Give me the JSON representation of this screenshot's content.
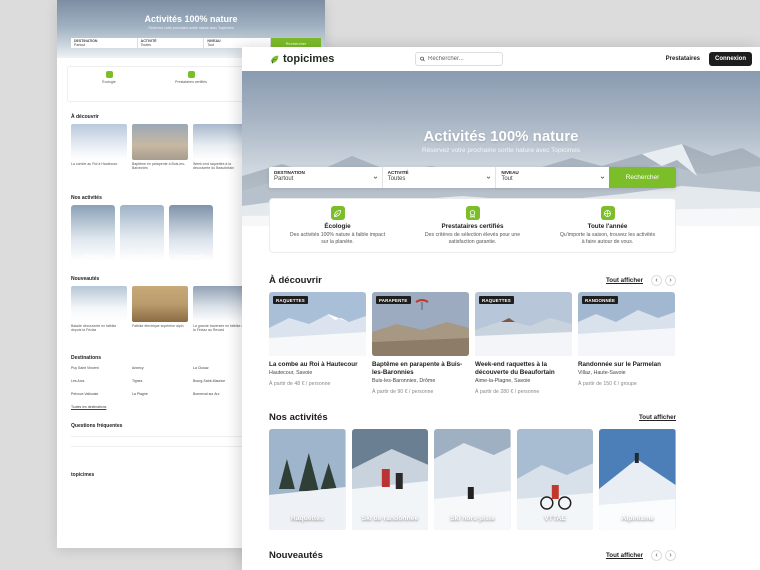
{
  "back_page": {
    "hero_title": "Activités 100% nature",
    "hero_sub": "Réservez votre prochaine sortie nature avec Topicimes",
    "search_fields": [
      {
        "label": "DESTINATION",
        "value": "Partout"
      },
      {
        "label": "ACTIVITÉ",
        "value": "Toutes"
      },
      {
        "label": "NIVEAU",
        "value": "Tout"
      }
    ],
    "search_button": "Rechercher",
    "features": [
      "Écologie",
      "Prestataires certifiés",
      "Toute l'année"
    ],
    "discover_title": "À découvrir",
    "cards": [
      {
        "badge": "RAQUETTES",
        "title": "La combe au Roi à Hautecour",
        "loc": "Hautecour, Savoie"
      },
      {
        "badge": "PARAPENTE",
        "title": "Baptême en parapente à Buis-les-Baronnies",
        "loc": "Buis-les-Baronnies, Drôme"
      },
      {
        "badge": "RAQUETTES",
        "title": "Week-end raquettes à la découverte du Beaufortain",
        "loc": "Aime-la-Plagne, Savoie"
      }
    ],
    "activities_title": "Nos activités",
    "activities": [
      "Raquettes",
      "Ski de randonnée",
      "Ski hors-piste"
    ],
    "news_title": "Nouveautés",
    "news": [
      {
        "badge": "FAT BIKE",
        "title": "Balade découverte en fatbike depuis la Féclaz"
      },
      {
        "badge": "FAT BIKE",
        "title": "Fatbike électrique supérieur alpin"
      },
      {
        "badge": "FAT BIKE",
        "title": "La grande traversée en fatbike de la Féclaz au Revard"
      }
    ],
    "destinations_title": "Destinations",
    "destinations": [
      "Puy Saint Vincent",
      "Annecy",
      "La Clusaz",
      "Les Arcs",
      "Tignes",
      "Bourg-Saint-Maurice",
      "Pelvoux Vallouise",
      "La Plagne",
      "Bonneval sur Arc"
    ],
    "all_destinations": "Toutes les destinations",
    "faq_title": "Questions fréquentes",
    "footer_brand": "topicimes"
  },
  "nav": {
    "brand": "topicimes",
    "search_placeholder": "Rechercher...",
    "link_providers": "Prestataires",
    "login": "Connexion"
  },
  "hero": {
    "title": "Activités 100% nature",
    "subtitle": "Réservez votre prochaine sortie nature avec Topicimes"
  },
  "search": {
    "fields": [
      {
        "label": "DESTINATION",
        "value": "Partout"
      },
      {
        "label": "ACTIVITÉ",
        "value": "Toutes"
      },
      {
        "label": "NIVEAU",
        "value": "Tout"
      }
    ],
    "button": "Rechercher"
  },
  "features": [
    {
      "icon": "leaf-icon",
      "title": "Écologie",
      "desc": "Des activités 100% nature à faible impact sur la planète."
    },
    {
      "icon": "certificate-icon",
      "title": "Prestataires certifiés",
      "desc": "Des critères de sélection élevés pour une satisfaction garantie."
    },
    {
      "icon": "sun-snow-icon",
      "title": "Toute l'année",
      "desc": "Qu'importe la saison, trouvez les activités à faire autour de vous."
    }
  ],
  "discover": {
    "title": "À découvrir",
    "see_all": "Tout afficher",
    "cards": [
      {
        "badge": "RAQUETTES",
        "title": "La combe au Roi à Hautecour",
        "location": "Hautecour, Savoie",
        "price": "À partir de 48 € / personne"
      },
      {
        "badge": "PARAPENTE",
        "title": "Baptême en parapente à Buis-les-Baronnies",
        "location": "Buis-les-Baronnies, Drôme",
        "price": "À partir de 90 € / personne"
      },
      {
        "badge": "RAQUETTES",
        "title": "Week-end raquettes à la découverte du Beaufortain",
        "location": "Aime-la-Plagne, Savoie",
        "price": "À partir de 280 € / personne"
      },
      {
        "badge": "RANDONNÉE",
        "title": "Randonnée sur le Parmelan",
        "location": "Villaz, Haute-Savoie",
        "price": "À partir de 150 € / groupe"
      }
    ]
  },
  "activities": {
    "title": "Nos activités",
    "see_all": "Tout afficher",
    "items": [
      "Raquettes",
      "Ski de randonnée",
      "Ski hors-piste",
      "VTTAE",
      "Alpinisme"
    ]
  },
  "news": {
    "title": "Nouveautés",
    "see_all": "Tout afficher"
  },
  "colors": {
    "accent": "#7cbd2a",
    "dark": "#1e1e1e"
  }
}
